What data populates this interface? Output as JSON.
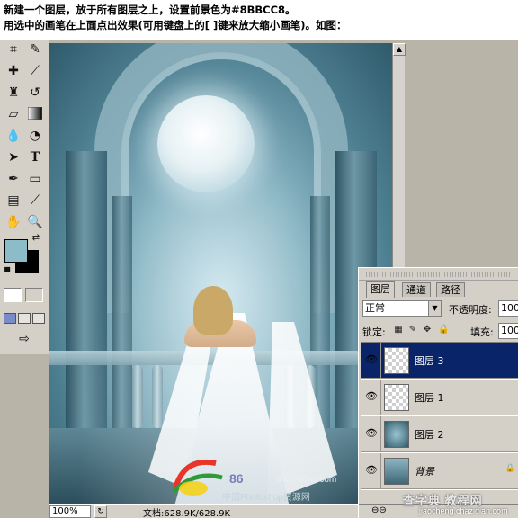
{
  "instructions": {
    "line1": "新建一个图层，放于所有图层之上，设置前景色为#8BBCC8。",
    "line2": "用选中的画笔在上面点出效果(可用键盘上的[ ]键来放大缩小画笔)。如图："
  },
  "toolbox": {
    "foreground_color": "#8BBCC8",
    "background_color": "#000000",
    "tools": [
      "crop-tool",
      "slice-tool",
      "healing-brush-tool",
      "brush-tool",
      "clone-stamp-tool",
      "history-brush-tool",
      "eraser-tool",
      "gradient-tool",
      "blur-tool",
      "dodge-tool",
      "path-selection-tool",
      "type-tool",
      "pen-tool",
      "shape-tool",
      "notes-tool",
      "eyedropper-tool",
      "hand-tool",
      "zoom-tool"
    ]
  },
  "canvas": {
    "logo_number": "86",
    "logo_url": "www.86ps.com",
    "logo_subtitle": "中国Photoshop资源网"
  },
  "status_bar": {
    "zoom": "100%",
    "document_info": "文档:628.9K/628.9K"
  },
  "layers_panel": {
    "tabs": [
      {
        "label": "图层",
        "active": true
      },
      {
        "label": "通道",
        "active": false
      },
      {
        "label": "路径",
        "active": false
      }
    ],
    "blend_mode": "正常",
    "opacity_label": "不透明度:",
    "opacity_value": "100",
    "lock_label": "锁定:",
    "fill_label": "填充:",
    "fill_value": "100",
    "layers": [
      {
        "name": "图层 3",
        "selected": true,
        "thumb": "transparent"
      },
      {
        "name": "图层 1",
        "selected": false,
        "thumb": "transparent"
      },
      {
        "name": "图层 2",
        "selected": false,
        "thumb": "teal"
      },
      {
        "name": "背景",
        "selected": false,
        "thumb": "photo",
        "locked": true
      }
    ]
  },
  "watermark": {
    "text": "查字典 教程网",
    "url": "jiaocheng.chazidian.com"
  }
}
